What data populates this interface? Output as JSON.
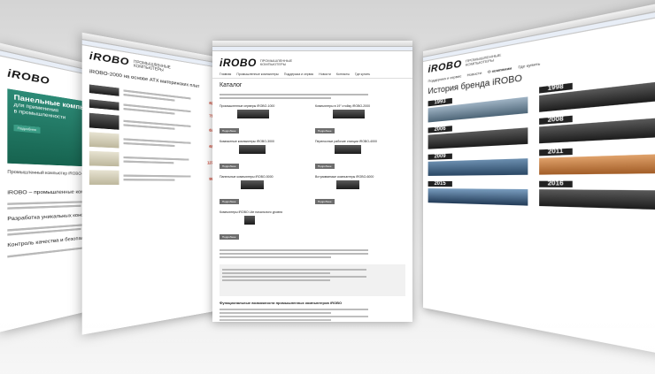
{
  "brand": {
    "logo": "iROBO",
    "tagline_line1": "ПРОМЫШЛЕННЫЕ",
    "tagline_line2": "КОМПЬЮТЕРЫ"
  },
  "center_page": {
    "nav": [
      "Главная",
      "Промышленные компьютеры",
      "Поддержка и сервис",
      "Новости",
      "Контакты",
      "Где купить"
    ],
    "heading": "Каталог",
    "products": [
      {
        "title": "Промышленные серверы iROBO-1000",
        "button": "Подробнее"
      },
      {
        "title": "Компьютеры в 19\" стойку iROBO-2000",
        "button": "Подробнее"
      },
      {
        "title": "Компактные компьютеры iROBO-3000",
        "button": "Подробнее"
      },
      {
        "title": "Переносные рабочие станции iROBO-4000",
        "button": "Подробнее"
      },
      {
        "title": "Панельные компьютеры iROBO-5000",
        "button": "Подробнее"
      },
      {
        "title": "Встраиваемые компьютеры iROBO-6000",
        "button": "Подробнее"
      },
      {
        "title": "Компьютеры iROBO Lite начального уровня",
        "button": "Подробнее"
      }
    ],
    "section_heading": "Функциональные возможности промышленных компьютеров iROBO"
  },
  "left_page": {
    "banner_title": "Панельные компьютеры",
    "banner_line2": "для применения",
    "banner_line3": "в промышленности",
    "banner_button": "Подробнее",
    "promo_title": "Промышленный компьютер iROBO-6000-11100",
    "youtube": "YouTube",
    "headline1": "iROBO – промышленные компьютеры",
    "headline2": "Разработка уникальных конфигураций",
    "headline3": "Контроль качества и безопасности"
  },
  "second_page": {
    "heading": "iROBO-2000 на основе ATX материнских плат",
    "prices": [
      "69 790",
      "71 690",
      "67 950",
      "68 790",
      "127 090",
      "99 790"
    ]
  },
  "right_page": {
    "nav": [
      "Поддержка и сервис",
      "Новости",
      "О компании",
      "Где купить"
    ],
    "heading": "История бренда iROBO",
    "years_left": [
      "1993",
      "2006",
      "2009",
      "2015"
    ],
    "years_right": [
      "1998",
      "2008",
      "2011",
      "2016"
    ]
  },
  "colors": {
    "accent_red": "#c8321e",
    "banner_green": "#1f7a66",
    "button_gray": "#6d6d6d"
  }
}
